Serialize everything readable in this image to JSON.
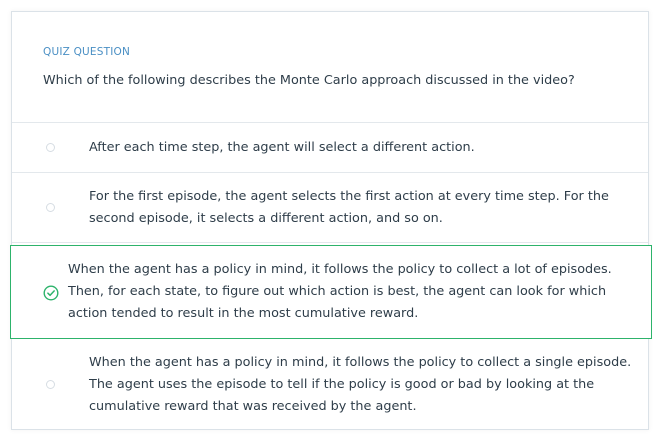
{
  "quiz": {
    "eyebrow": "QUIZ QUESTION",
    "question": "Which of the following describes the Monte Carlo approach discussed in the video?",
    "options": [
      {
        "lines": [
          "After each time step, the agent will select a different action."
        ],
        "selected": false
      },
      {
        "lines": [
          "For the first episode, the agent selects the first action at every time step. For the",
          "second episode, it selects a different action, and so on."
        ],
        "selected": false
      },
      {
        "lines": [
          "When the agent has a policy in mind, it follows the policy to collect a lot of episodes.",
          "Then, for each state, to figure out which action is best, the agent can look for which",
          "action tended to result in the most cumulative reward."
        ],
        "selected": true
      },
      {
        "lines": [
          "When the agent has a policy in mind, it follows the policy to collect a single episode.",
          "The agent uses the episode to tell if the policy is good or bad by looking at the",
          "cumulative reward that was received by the agent."
        ],
        "selected": false
      }
    ]
  },
  "colors": {
    "eyebrow": "#4a8fc4",
    "text": "#2e3d49",
    "selected_border": "#2db36b",
    "check": "#2db36b",
    "divider": "#e3e8ec"
  },
  "icons": {
    "radio": "radio-unchecked-icon",
    "selected": "check-circle-icon"
  }
}
